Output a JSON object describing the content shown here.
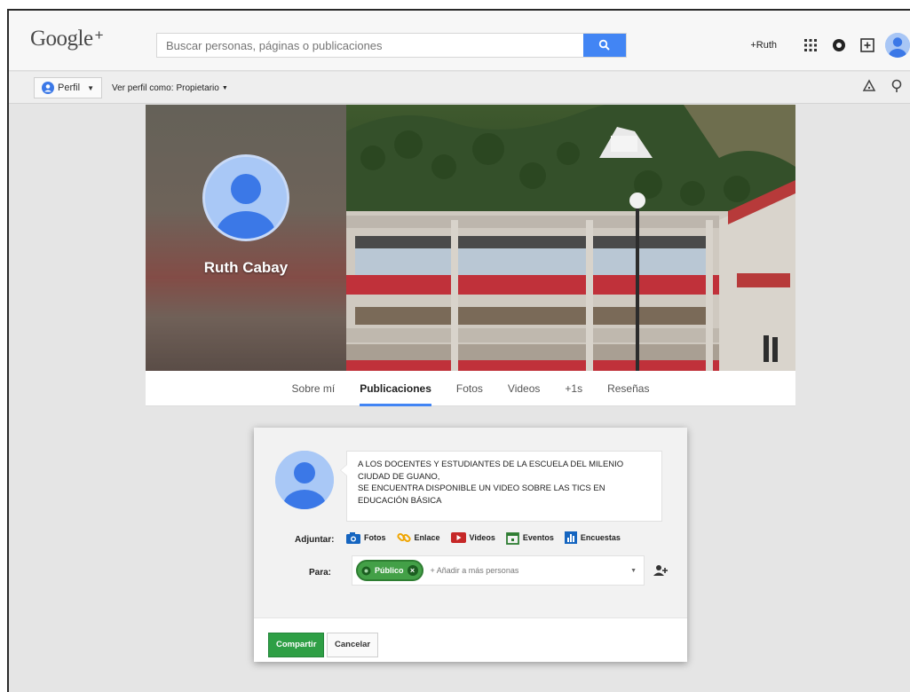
{
  "app": {
    "logo": "Google",
    "logo_plus": "+"
  },
  "search": {
    "placeholder": "Buscar personas, páginas o publicaciones"
  },
  "topbar": {
    "user_link": "+Ruth"
  },
  "subbar": {
    "perfil_label": "Perfil",
    "view_as_label": "Ver perfil como:",
    "view_as_value": "Propietario"
  },
  "profile": {
    "name": "Ruth Cabay"
  },
  "tabs": [
    {
      "label": "Sobre mí",
      "active": false
    },
    {
      "label": "Publicaciones",
      "active": true
    },
    {
      "label": "Fotos",
      "active": false
    },
    {
      "label": "Videos",
      "active": false
    },
    {
      "label": "+1s",
      "active": false
    },
    {
      "label": "Reseñas",
      "active": false
    }
  ],
  "share": {
    "post_text": "A LOS DOCENTES Y ESTUDIANTES DE LA ESCUELA DEL MILENIO\nCIUDAD DE GUANO,\nSE ENCUENTRA DISPONIBLE UN VIDEO SOBRE LAS TICS EN\nEDUCACIÓN BÁSICA",
    "attach_label": "Adjuntar:",
    "attach_items": [
      {
        "label": "Fotos",
        "icon": "camera-icon",
        "color": "#1565c0"
      },
      {
        "label": "Enlace",
        "icon": "link-icon",
        "color": "#f0a500"
      },
      {
        "label": "Videos",
        "icon": "video-icon",
        "color": "#c62828"
      },
      {
        "label": "Eventos",
        "icon": "calendar-icon",
        "color": "#2e7d32"
      },
      {
        "label": "Encuestas",
        "icon": "poll-icon",
        "color": "#1565c0"
      }
    ],
    "to_label": "Para:",
    "audience_chip": "Público",
    "add_more_placeholder": "+ Añadir a más personas",
    "share_button": "Compartir",
    "cancel_button": "Cancelar"
  },
  "colors": {
    "accent_blue": "#4285f4",
    "share_green": "#2e9f45",
    "chip_green": "#43a047"
  }
}
